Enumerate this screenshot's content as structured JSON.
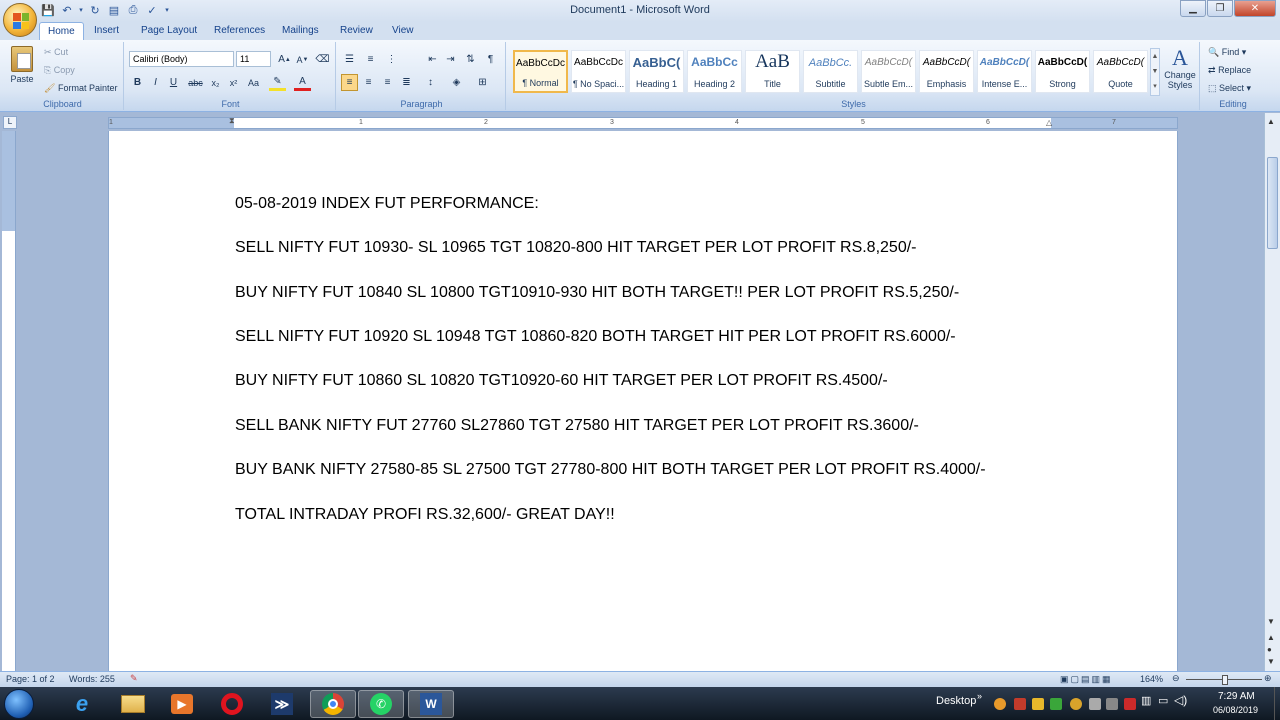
{
  "window": {
    "title": "Document1 - Microsoft Word"
  },
  "tabs": [
    "Home",
    "Insert",
    "Page Layout",
    "References",
    "Mailings",
    "Review",
    "View"
  ],
  "clipboard": {
    "paste": "Paste",
    "cut": "Cut",
    "copy": "Copy",
    "format_painter": "Format Painter",
    "label": "Clipboard"
  },
  "font": {
    "name": "Calibri (Body)",
    "size": "11",
    "label": "Font"
  },
  "paragraph": {
    "label": "Paragraph"
  },
  "styles": {
    "label": "Styles",
    "items": [
      {
        "sample": "AaBbCcDc",
        "name": "¶ Normal"
      },
      {
        "sample": "AaBbCcDc",
        "name": "¶ No Spaci..."
      },
      {
        "sample": "AaBbC(",
        "name": "Heading 1"
      },
      {
        "sample": "AaBbCc",
        "name": "Heading 2"
      },
      {
        "sample": "AaB",
        "name": "Title"
      },
      {
        "sample": "AaBbCc.",
        "name": "Subtitle"
      },
      {
        "sample": "AaBbCcD(",
        "name": "Subtle Em..."
      },
      {
        "sample": "AaBbCcD(",
        "name": "Emphasis"
      },
      {
        "sample": "AaBbCcD(",
        "name": "Intense E..."
      },
      {
        "sample": "AaBbCcD(",
        "name": "Strong"
      },
      {
        "sample": "AaBbCcD(",
        "name": "Quote"
      }
    ],
    "change_styles": "Change Styles"
  },
  "editing": {
    "find": "Find",
    "replace": "Replace",
    "select": "Select",
    "label": "Editing"
  },
  "document": {
    "lines": [
      "05-08-2019 INDEX FUT PERFORMANCE:",
      "SELL NIFTY FUT 10930- SL 10965 TGT 10820-800 HIT TARGET PER LOT PROFIT RS.8,250/-",
      "BUY NIFTY FUT 10840 SL 10800 TGT10910-930 HIT BOTH TARGET!! PER LOT PROFIT RS.5,250/-",
      "SELL NIFTY FUT 10920 SL 10948 TGT 10860-820 BOTH TARGET HIT PER LOT PROFIT RS.6000/-",
      "BUY NIFTY FUT 10860 SL 10820 TGT10920-60 HIT TARGET PER LOT PROFIT RS.4500/-",
      "SELL BANK NIFTY FUT 27760 SL27860 TGT 27580 HIT TARGET PER LOT PROFIT RS.3600/-",
      "BUY BANK NIFTY 27580-85 SL 27500 TGT 27780-800 HIT BOTH TARGET PER LOT PROFIT RS.4000/-",
      "TOTAL INTRADAY PROFI RS.32,600/- GREAT DAY!!"
    ]
  },
  "ruler_numbers": [
    "1",
    "1",
    "2",
    "3",
    "4",
    "5",
    "6",
    "7"
  ],
  "status": {
    "page": "Page: 1 of 2",
    "words": "Words: 255",
    "zoom": "164%"
  },
  "taskbar": {
    "desktop": "Desktop",
    "time": "7:29 AM",
    "date": "06/08/2019"
  }
}
